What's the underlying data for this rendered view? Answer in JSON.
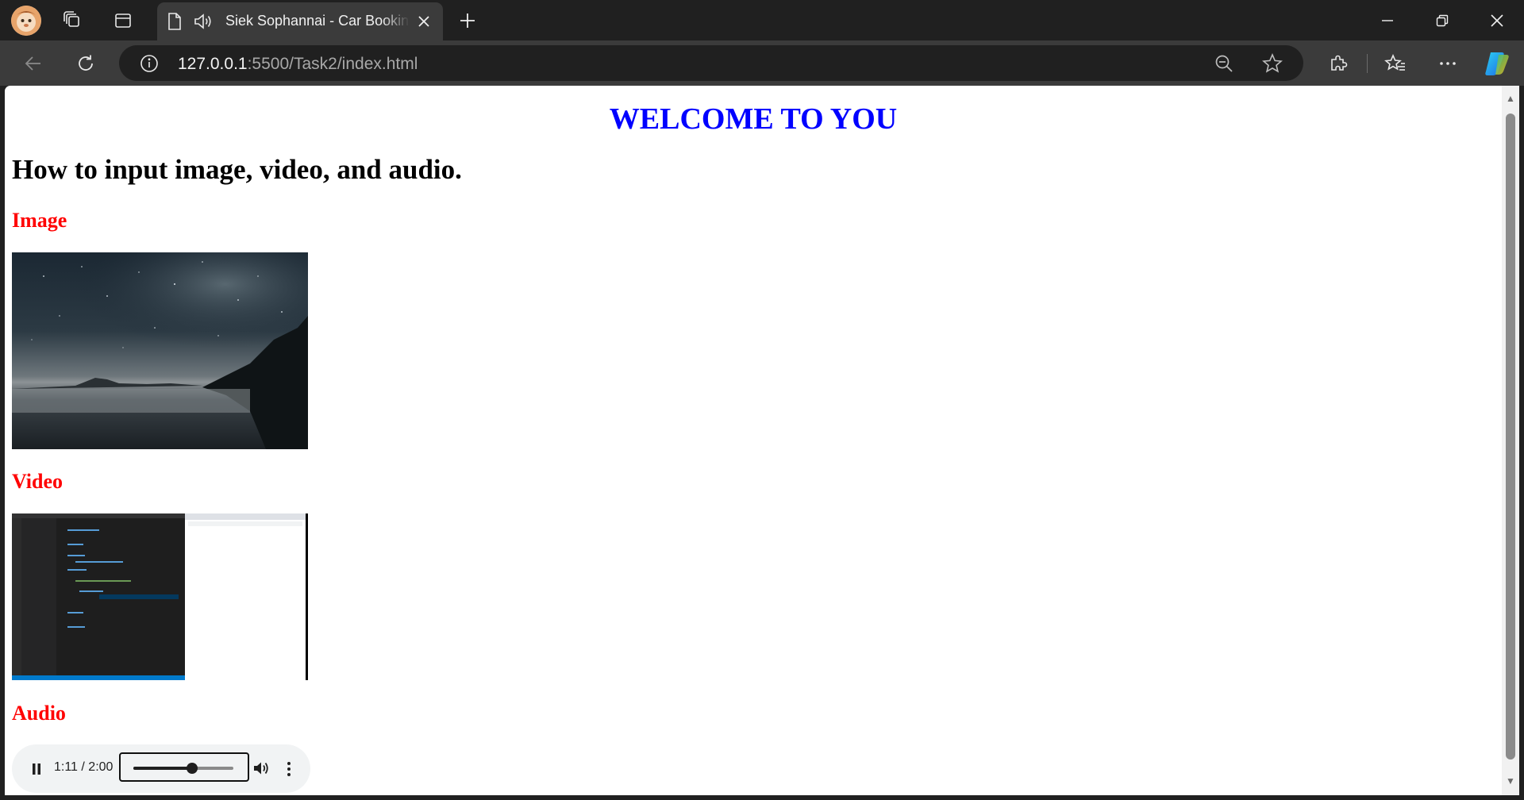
{
  "browser": {
    "tab": {
      "title": "Siek Sophannai - Car Booking"
    },
    "address": {
      "host": "127.0.0.1",
      "path": ":5500/Task2/index.html"
    },
    "icons": {
      "profile": "profile-avatar",
      "workspaces": "workspaces-icon",
      "vertical_tabs": "tab-actions-icon",
      "page": "page-icon",
      "audio": "speaker-icon",
      "close_tab": "close-icon",
      "new_tab": "plus-icon",
      "back": "back-arrow-icon",
      "reload": "reload-icon",
      "site_info": "info-icon",
      "zoom": "zoom-out-icon",
      "favorite": "star-icon",
      "extensions": "puzzle-icon",
      "favorites": "favorites-icon",
      "more": "more-icon",
      "copilot": "copilot-icon"
    }
  },
  "page": {
    "welcome": "WELCOME TO YOU",
    "heading": "How to input image, video, and audio.",
    "sections": {
      "image": "Image",
      "video": "Video",
      "audio": "Audio"
    },
    "audio_player": {
      "current_time": "1:11",
      "duration": "2:00",
      "time_display": "1:11 / 2:00",
      "progress_fraction": 0.59
    }
  },
  "colors": {
    "welcome": "#0000ff",
    "section_heading": "#ff0000",
    "browser_frame": "#202020",
    "toolbar": "#3b3b3b"
  }
}
